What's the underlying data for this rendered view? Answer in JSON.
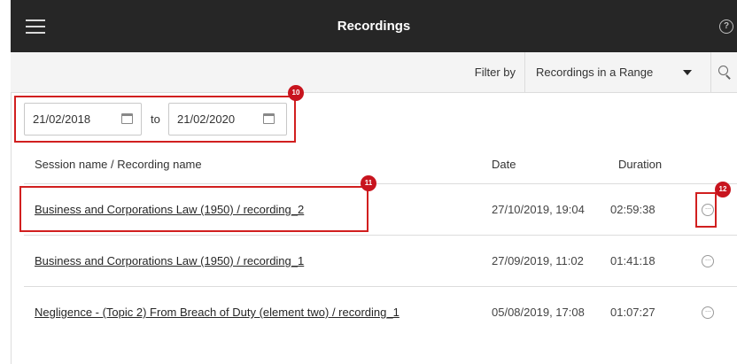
{
  "header": {
    "title": "Recordings",
    "menu_icon": "hamburger-menu-icon",
    "help_icon": "help-icon",
    "help_glyph": "?"
  },
  "filter": {
    "label": "Filter by",
    "selected": "Recordings in a Range",
    "search_icon": "search-icon"
  },
  "date_range": {
    "from": "21/02/2018",
    "to_label": "to",
    "to": "21/02/2020"
  },
  "columns": {
    "name": "Session name / Recording name",
    "date": "Date",
    "duration": "Duration"
  },
  "recordings": [
    {
      "name": "Business and Corporations Law (1950) / recording_2",
      "date": "27/10/2019, 19:04",
      "duration": "02:59:38"
    },
    {
      "name": "Business and Corporations Law (1950) / recording_1",
      "date": "27/09/2019, 11:02",
      "duration": "01:41:18"
    },
    {
      "name": "Negligence - (Topic 2) From Breach of Duty (element two) / recording_1",
      "date": "05/08/2019, 17:08",
      "duration": "01:07:27"
    }
  ],
  "annotations": {
    "date_range_badge": "10",
    "recording_badge": "11",
    "more_badge": "12",
    "highlight_color": "#d11f1f"
  },
  "more_glyph": "···",
  "colors": {
    "header_bg": "#262626",
    "filter_bg": "#f4f4f4",
    "badge_red": "#c8141e"
  }
}
